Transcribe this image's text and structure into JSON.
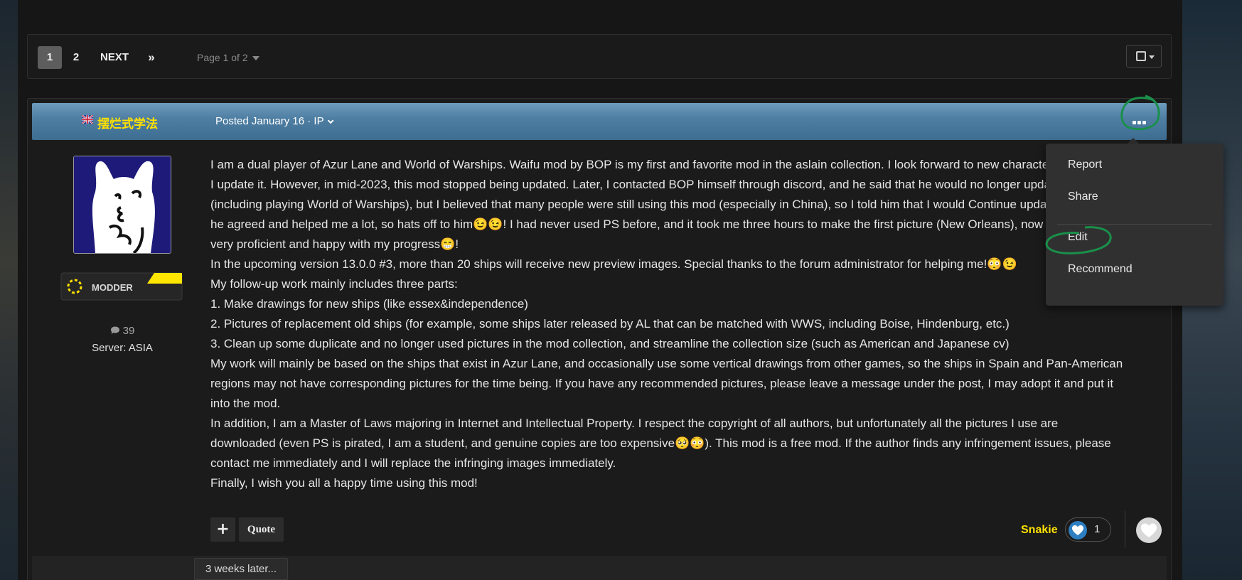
{
  "pagination": {
    "pages": [
      "1",
      "2"
    ],
    "next_label": "NEXT",
    "last_label": "»",
    "page_info": "Page 1 of 2"
  },
  "post": {
    "author": "摆烂式学法",
    "posted": "Posted January 16 · IP",
    "rank": "MODDER",
    "post_count": "39",
    "server": "Server: ASIA",
    "content_lines": [
      "I am a dual player of Azur Lane and World of Warships. Waifu mod by BOP is my first and favorite mod in the aslain collection. I look forward to new characters every time",
      "I update it. However, in mid-2023, this mod stopped being updated. Later, I contacted BOP himself through discord, and he said that he would no longer update this mod",
      "(including playing World of Warships), but I believed that many people were still using this mod (especially in China), so I told him that I would Continue updating it,",
      "he agreed and helped me a lot, so hats off to him😉😉! I had never used PS before, and it took me three hours to make the first picture (New Orleans), now I am",
      "very proficient and happy with my progress😁!",
      "In the upcoming version 13.0.0 #3, more than 20 ships will receive new preview images. Special thanks to the forum administrator for helping me!😳😉",
      "My follow-up work mainly includes three parts:",
      "1. Make drawings for new ships (like essex&independence)",
      "2. Pictures of replacement old ships (for example, some ships later released by AL that can be matched with WWS, including Boise, Hindenburg, etc.)",
      "3. Clean up some duplicate and no longer used pictures in the mod collection, and streamline the collection size (such as American and Japanese cv)",
      "My work will mainly be based on the ships that exist in Azur Lane, and occasionally use some vertical drawings from other games, so the ships in Spain and Pan-American",
      "regions may not have corresponding pictures for the time being. If you have any recommended pictures, please leave a message under the post, I may adopt it and put it",
      "into the mod.",
      "In addition, I am a Master of Laws majoring in Internet and Intellectual Property. I respect the copyright of all authors, but unfortunately all the pictures I use are",
      "downloaded (even PS is pirated, I am a student, and genuine copies are too expensive🥺😳). This mod is a free mod. If the author finds any infringement issues, please",
      "contact me immediately and I will replace the infringing images immediately.",
      "Finally, I wish you all a happy time using this mod!"
    ],
    "plus_label": "+",
    "quote_label": "Quote",
    "liker": "Snakie",
    "like_count": "1",
    "later_label": "3 weeks later..."
  },
  "menu": {
    "items": [
      "Report",
      "Share",
      "Edit",
      "Recommend"
    ]
  },
  "colors": {
    "author": "#ffe100",
    "header": "#4f7fa3",
    "annotation": "#1a8f4a"
  },
  "icons": {
    "more": "ellipsis-icon",
    "comment": "comment-icon",
    "like": "heart-icon",
    "select": "checkbox-icon"
  }
}
